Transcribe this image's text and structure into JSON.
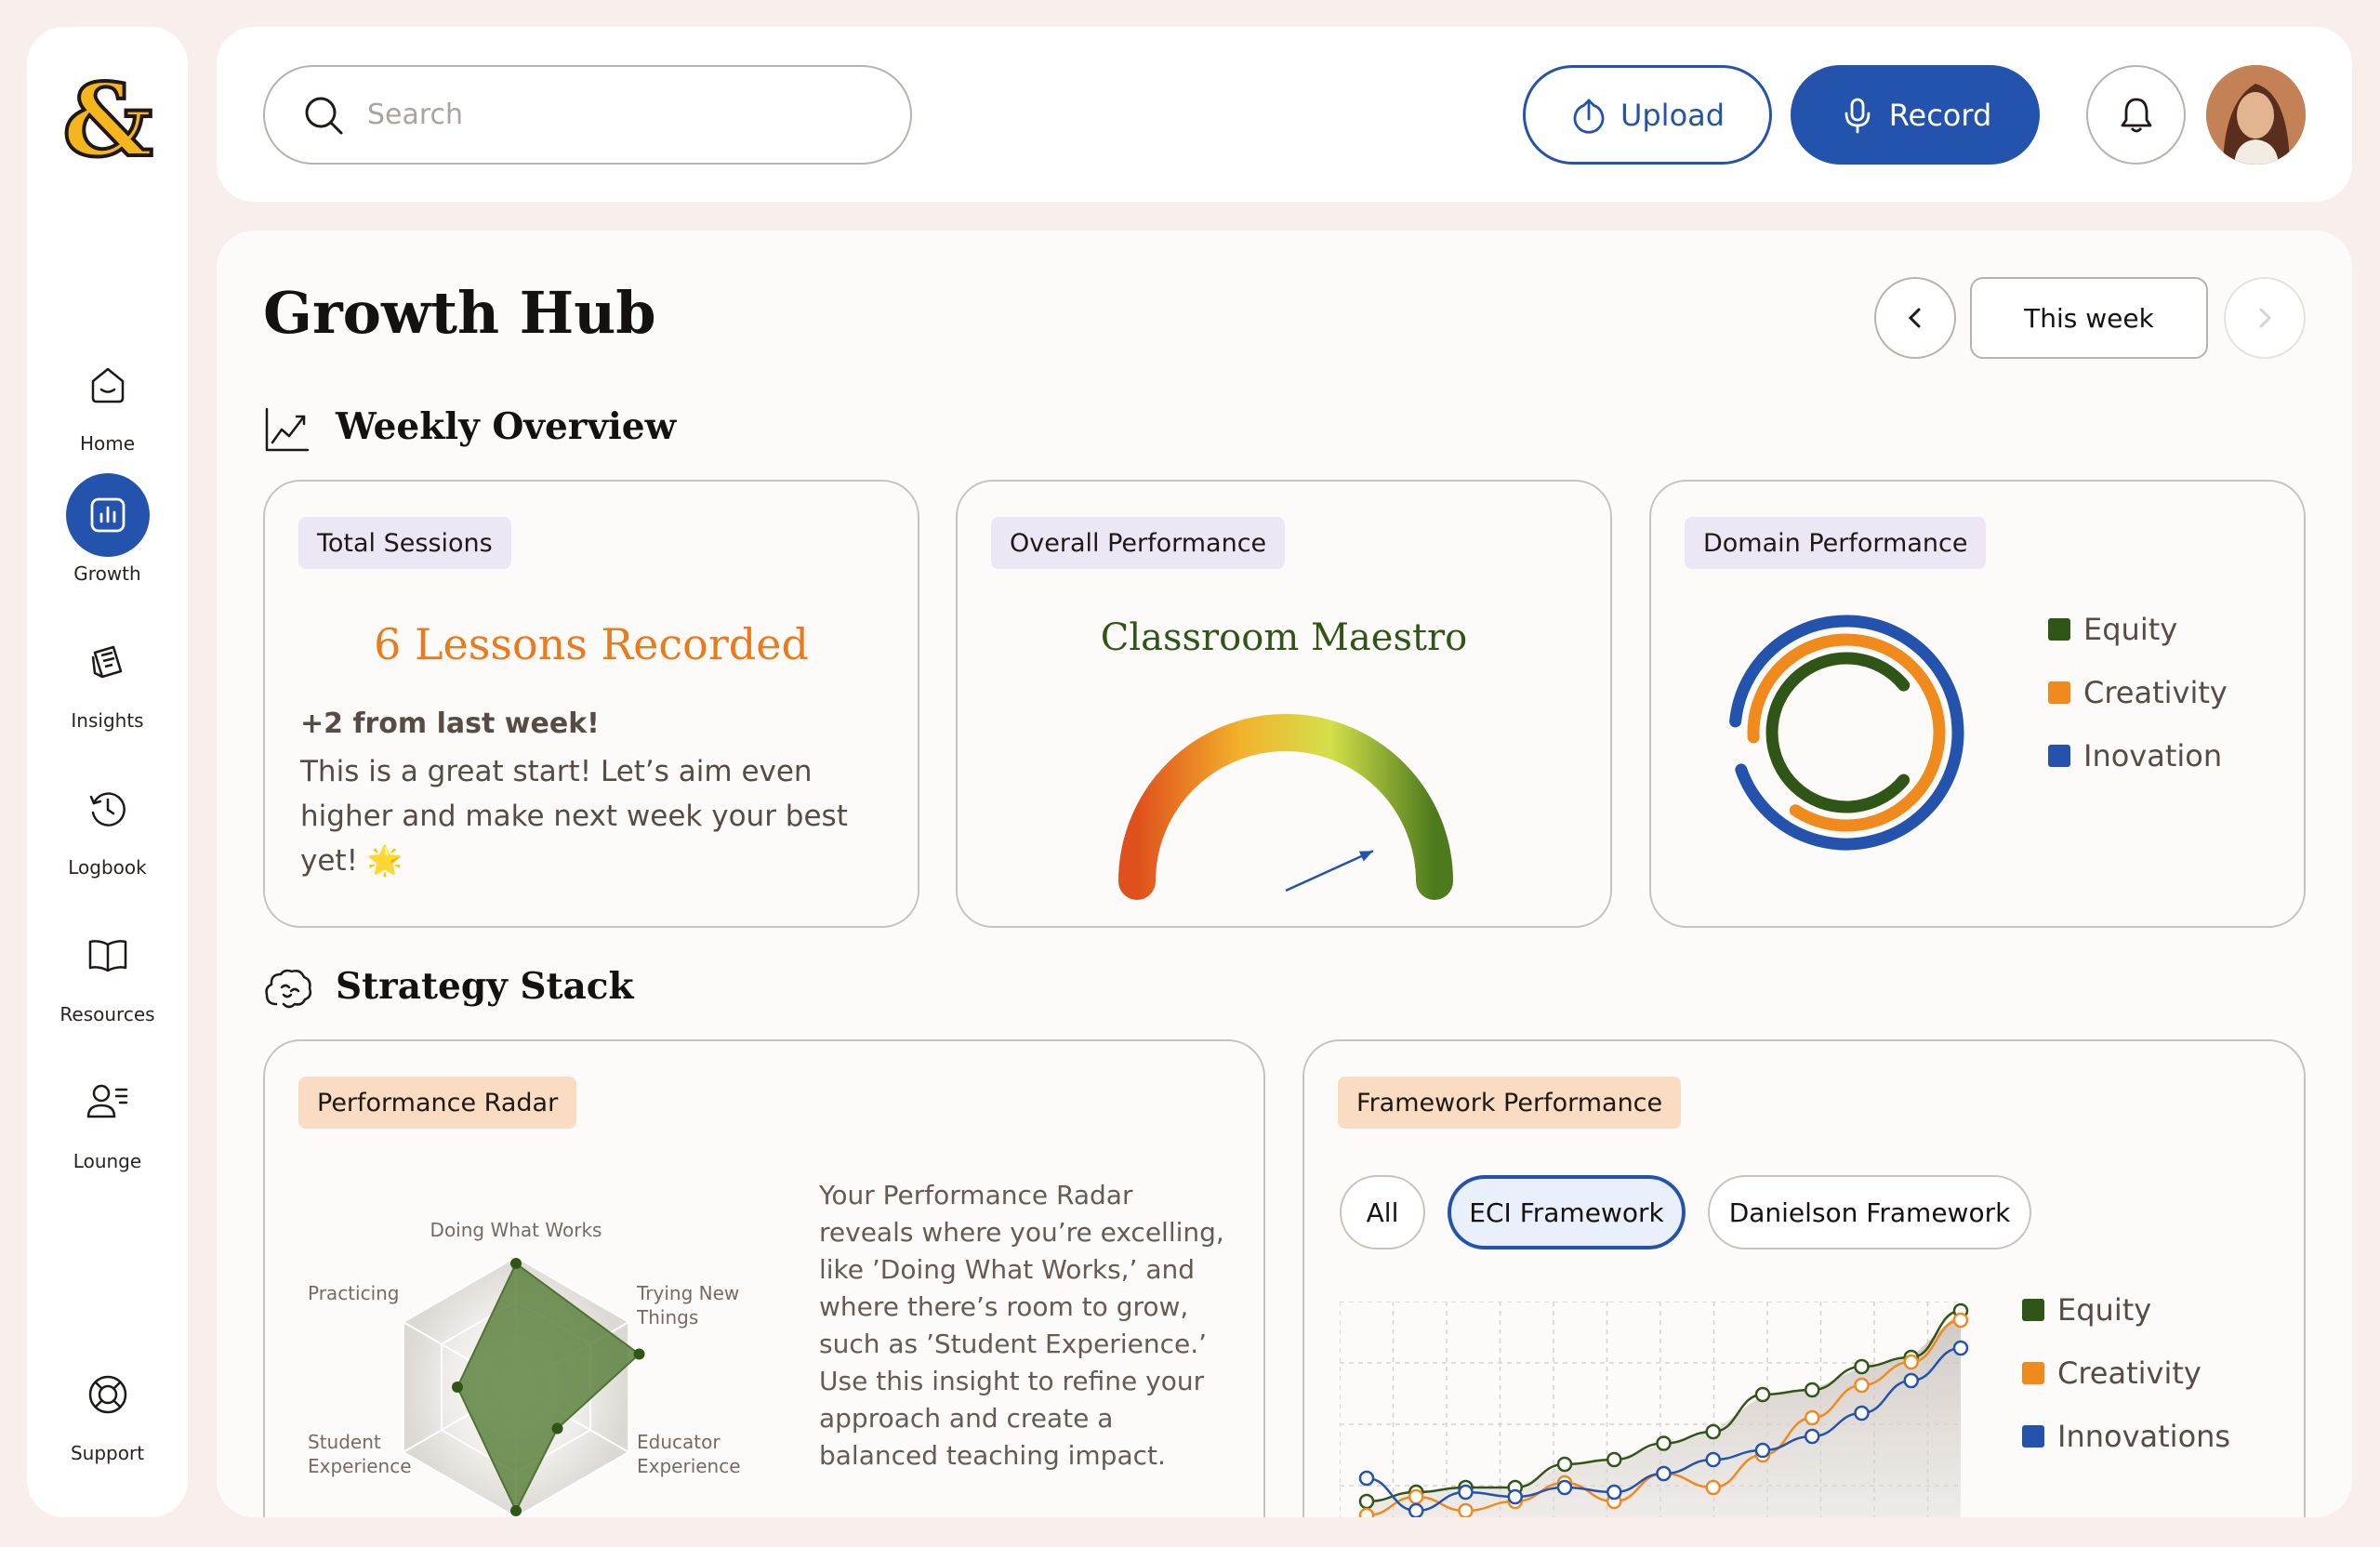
{
  "sidebar": {
    "items": [
      {
        "label": "Home",
        "icon": "home-icon"
      },
      {
        "label": "Growth",
        "icon": "bar-chart-icon",
        "active": true
      },
      {
        "label": "Insights",
        "icon": "notes-icon"
      },
      {
        "label": "Logbook",
        "icon": "clock-history-icon"
      },
      {
        "label": "Resources",
        "icon": "open-book-icon"
      },
      {
        "label": "Lounge",
        "icon": "user-list-icon"
      }
    ],
    "support_label": "Support"
  },
  "header": {
    "search_placeholder": "Search",
    "upload_label": "Upload",
    "record_label": "Record"
  },
  "main": {
    "title": "Growth Hub",
    "week_label": "This week",
    "weekly_overview": {
      "title": "Weekly Overview",
      "total_sessions": {
        "tag": "Total Sessions",
        "headline": "6 Lessons Recorded",
        "delta": "+2 from last week!",
        "message": "This is a great start! Let’s aim even higher and make next week your best yet! 🌟"
      },
      "overall_performance": {
        "tag": "Overall Performance",
        "rating": "Classroom Maestro",
        "gauge_level": 0.78
      },
      "domain_performance": {
        "tag": "Domain Performance",
        "legend": [
          {
            "label": "Equity",
            "color": "#2f5517"
          },
          {
            "label": "Creativity",
            "color": "#f08a1d"
          },
          {
            "label": "Inovation",
            "color": "#2353ad"
          }
        ]
      }
    },
    "strategy_stack": {
      "title": "Strategy Stack",
      "performance_radar": {
        "tag": "Performance Radar",
        "axes": [
          "Doing What Works",
          "Trying New Things",
          "Educator Experience",
          "Student Experience",
          "Practicing"
        ],
        "description": "Your Performance Radar reveals where you’re excelling, like ’Doing What Works,’ and where there’s room to grow, such as ’Student Experience.’ Use this insight to refine your approach and create a balanced teaching impact."
      },
      "framework_performance": {
        "tag": "Framework Performance",
        "filters": [
          "All",
          "ECI Framework",
          "Danielson Framework"
        ],
        "active_filter": "ECI Framework",
        "legend": [
          {
            "label": "Equity",
            "color": "#2f5517"
          },
          {
            "label": "Creativity",
            "color": "#f08a1d"
          },
          {
            "label": "Innovations",
            "color": "#2353ad"
          }
        ]
      }
    }
  },
  "chart_data": [
    {
      "type": "radial-bar",
      "series": [
        {
          "name": "Equity",
          "value": 0.78
        },
        {
          "name": "Creativity",
          "value": 0.85
        },
        {
          "name": "Inovation",
          "value": 0.93
        }
      ]
    },
    {
      "type": "radar",
      "categories": [
        "Doing What Works",
        "Trying New Things",
        "Educator Experience",
        "Student Experience",
        "Practicing"
      ],
      "values": [
        0.95,
        0.98,
        0.45,
        0.95,
        0.45
      ],
      "range": [
        0,
        1
      ]
    },
    {
      "type": "line",
      "x": [
        0,
        1,
        2,
        3,
        4,
        5,
        6,
        7,
        8,
        9,
        10,
        11,
        12
      ],
      "series": [
        {
          "name": "Equity",
          "values": [
            10,
            14,
            16,
            16,
            26,
            28,
            35,
            40,
            56,
            58,
            68,
            72,
            92
          ]
        },
        {
          "name": "Creativity",
          "values": [
            4,
            12,
            6,
            10,
            18,
            10,
            22,
            16,
            30,
            46,
            60,
            70,
            88
          ]
        },
        {
          "name": "Innovations",
          "values": [
            20,
            6,
            14,
            12,
            16,
            14,
            22,
            28,
            32,
            38,
            48,
            62,
            76
          ]
        }
      ]
    }
  ]
}
